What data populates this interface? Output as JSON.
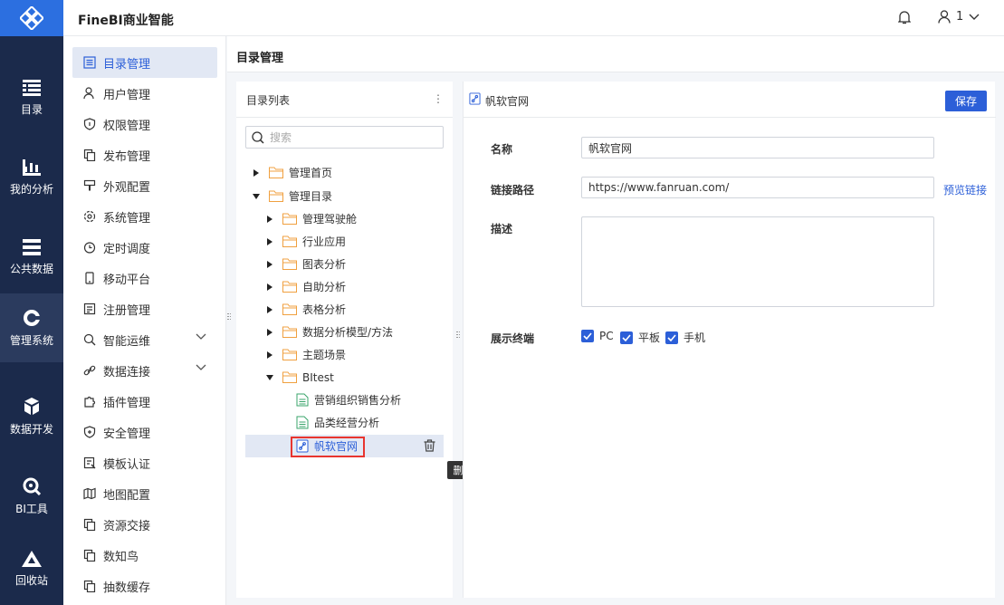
{
  "app": {
    "title": "FineBI商业智能",
    "user": "1"
  },
  "nav": [
    {
      "label": "目录",
      "icon": "catalog-icon"
    },
    {
      "label": "我的分析",
      "icon": "analysis-icon"
    },
    {
      "label": "公共数据",
      "icon": "database-icon"
    },
    {
      "label": "管理系统",
      "icon": "gear-icon",
      "active": true
    },
    {
      "label": "数据开发",
      "icon": "cube-icon"
    },
    {
      "label": "BI工具",
      "icon": "tool-icon"
    },
    {
      "label": "回收站",
      "icon": "recycle-icon"
    }
  ],
  "submenu": [
    {
      "label": "目录管理",
      "active": true
    },
    {
      "label": "用户管理"
    },
    {
      "label": "权限管理"
    },
    {
      "label": "发布管理"
    },
    {
      "label": "外观配置"
    },
    {
      "label": "系统管理"
    },
    {
      "label": "定时调度"
    },
    {
      "label": "移动平台"
    },
    {
      "label": "注册管理"
    },
    {
      "label": "智能运维",
      "expandable": true
    },
    {
      "label": "数据连接",
      "expandable": true
    },
    {
      "label": "插件管理"
    },
    {
      "label": "安全管理"
    },
    {
      "label": "模板认证"
    },
    {
      "label": "地图配置"
    },
    {
      "label": "资源交接"
    },
    {
      "label": "数知鸟"
    },
    {
      "label": "抽数缓存"
    }
  ],
  "content": {
    "title": "目录管理"
  },
  "dir": {
    "title": "目录列表",
    "more": "⋮",
    "search_placeholder": "搜索",
    "tree": [
      {
        "label": "管理首页",
        "type": "folder",
        "state": "collapsed"
      },
      {
        "label": "管理目录",
        "type": "folder",
        "state": "expanded"
      },
      {
        "label": "管理驾驶舱",
        "type": "folder",
        "state": "collapsed"
      },
      {
        "label": "行业应用",
        "type": "folder",
        "state": "collapsed"
      },
      {
        "label": "图表分析",
        "type": "folder",
        "state": "collapsed"
      },
      {
        "label": "自助分析",
        "type": "folder",
        "state": "collapsed"
      },
      {
        "label": "表格分析",
        "type": "folder",
        "state": "collapsed"
      },
      {
        "label": "数据分析模型/方法",
        "type": "folder",
        "state": "collapsed"
      },
      {
        "label": "主题场景",
        "type": "folder",
        "state": "collapsed"
      },
      {
        "label": "BItest",
        "type": "folder",
        "state": "expanded"
      },
      {
        "label": "营销组织销售分析",
        "type": "report"
      },
      {
        "label": "品类经营分析",
        "type": "report"
      },
      {
        "label": "帆软官网",
        "type": "link",
        "selected": true
      }
    ],
    "delete_tooltip": "删除"
  },
  "detail": {
    "title": "帆软官网",
    "save_label": "保存",
    "name_label": "名称",
    "name_value": "帆软官网",
    "path_label": "链接路径",
    "path_value": "https://www.fanruan.com/",
    "preview_label": "预览链接",
    "desc_label": "描述",
    "terminal_label": "展示终端",
    "terminals": [
      "PC",
      "平板",
      "手机"
    ]
  },
  "colors": {
    "nav_bg": "#1b2a4b",
    "accent": "#2c5fd8",
    "logo_bg": "#2c6fe0",
    "highlight_red": "#e8352f"
  }
}
